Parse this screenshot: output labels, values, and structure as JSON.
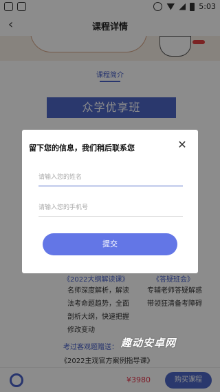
{
  "status_bar": {
    "time": "5:03"
  },
  "nav": {
    "back_icon": "chevron-left-icon",
    "title": "课程详情"
  },
  "section": {
    "label": "课程简介"
  },
  "course": {
    "name": "众学优享班"
  },
  "background": {
    "left_title": "《2022大纲解读课》",
    "left_desc": [
      "名师深度解析，解读",
      "法考命题趋势，全面",
      "剖析大纲，快速把握",
      "修改变动"
    ],
    "right_title": "《答疑班会》",
    "right_desc": [
      "专辅老师答疑解惑",
      "带领狂清备考障碍"
    ],
    "gift_label": "考过客观题赠送：",
    "gift_item": "《2022主观官方案例指导课》"
  },
  "bottom_bar": {
    "price": "¥3980",
    "buy_label": "购买课程"
  },
  "modal": {
    "title": "留下您的信息，我们稍后联系您",
    "name_placeholder": "请输入您的姓名",
    "phone_placeholder": "请输入您的手机号",
    "submit_label": "提交"
  },
  "watermark": "趣动安卓网",
  "colors": {
    "accent": "#4d67c7",
    "button": "#6376e6",
    "price": "#e6334b"
  }
}
